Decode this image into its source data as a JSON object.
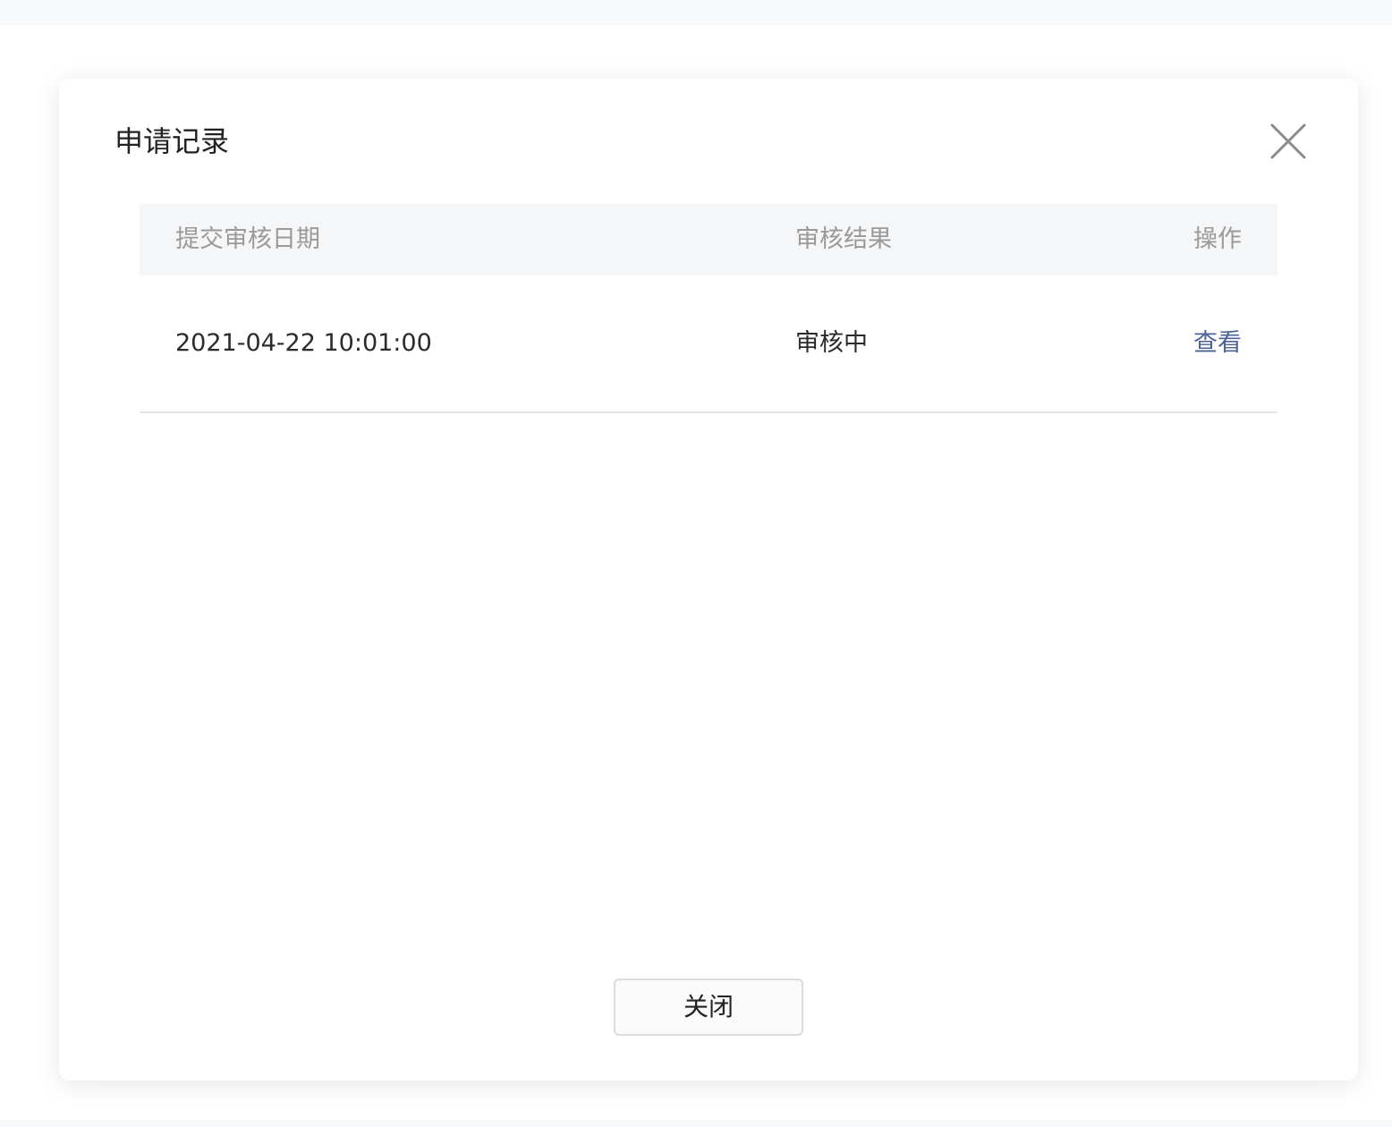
{
  "dialog": {
    "title": "申请记录",
    "close_icon": "close-icon"
  },
  "table": {
    "columns": [
      "提交审核日期",
      "审核结果",
      "操作"
    ],
    "rows": [
      {
        "date": "2021-04-22 10:01:00",
        "result": "审核中",
        "action": "查看"
      }
    ]
  },
  "footer": {
    "close_label": "关闭"
  },
  "colors": {
    "link": "#4b6396",
    "header_bg": "#f5f6f8",
    "header_text": "#9a9a9a"
  }
}
